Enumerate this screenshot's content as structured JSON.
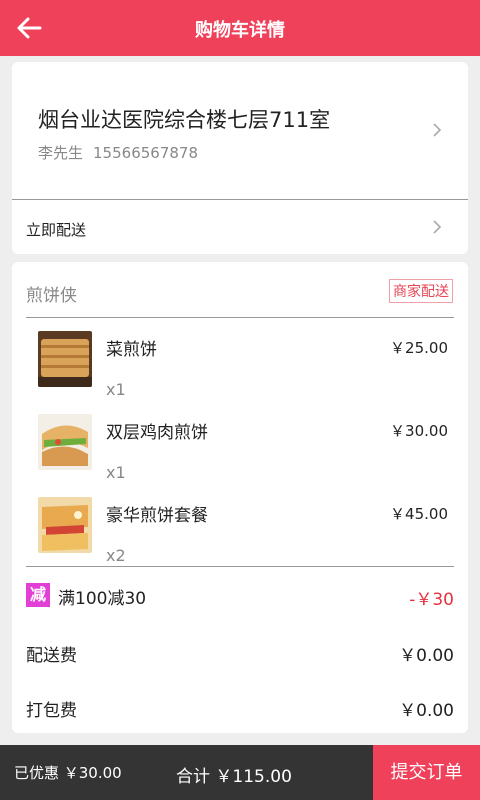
{
  "header": {
    "title": "购物车详情",
    "back_icon": "arrow-left-icon"
  },
  "address": {
    "line": "烟台业达医院综合楼七层711室",
    "name": "李先生",
    "phone": "15566567878"
  },
  "delivery": {
    "label": "立即配送"
  },
  "shop": {
    "name": "煎饼侠",
    "shipping_tag": "商家配送",
    "items": [
      {
        "name": "菜煎饼",
        "price": "￥25.00",
        "qty": "x1"
      },
      {
        "name": "双层鸡肉煎饼",
        "price": "￥30.00",
        "qty": "x1"
      },
      {
        "name": "豪华煎饼套餐",
        "price": "￥45.00",
        "qty": "x2"
      }
    ]
  },
  "promo": {
    "badge": "减",
    "text": "满100减30",
    "amount": "-￥30"
  },
  "fees": {
    "delivery_label": "配送费",
    "delivery_value": "￥0.00",
    "packing_label": "打包费",
    "packing_value": "￥0.00"
  },
  "footer": {
    "discount": "已优惠 ￥30.00",
    "total": "合计 ￥115.00",
    "submit": "提交订单"
  },
  "colors": {
    "accent": "#f0415a",
    "promo_badge": "#e23fd6",
    "footer_bg": "#343434"
  }
}
